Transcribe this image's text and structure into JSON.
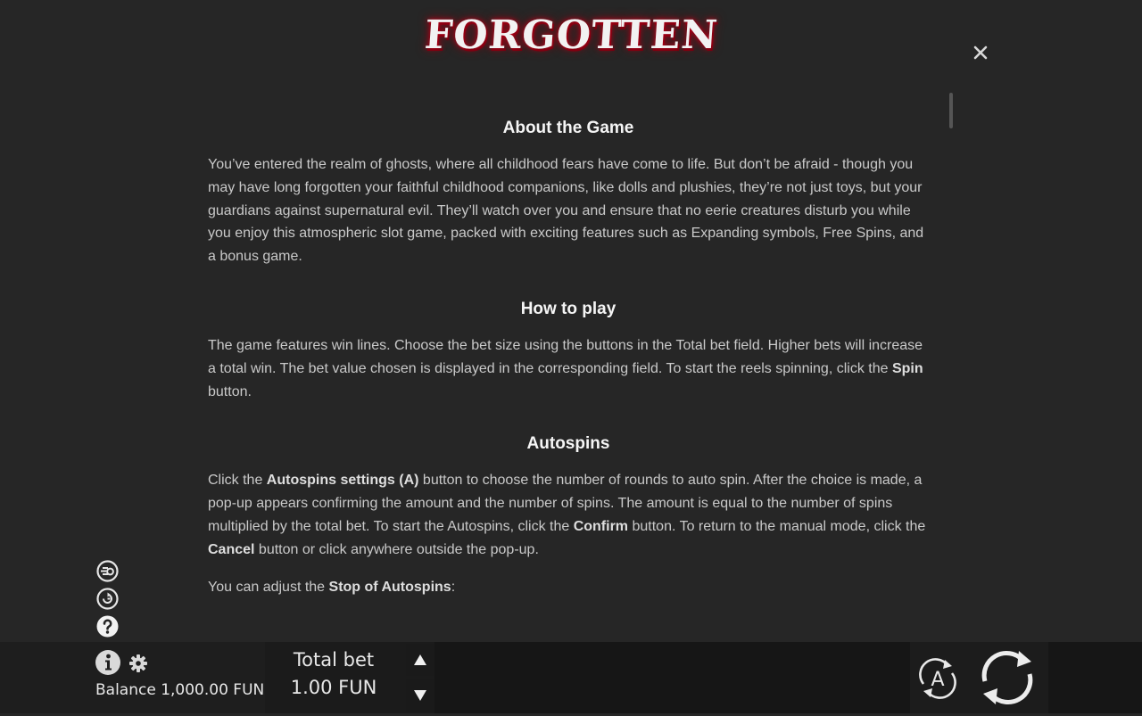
{
  "header": {
    "logo_text": "FORGOTTEN"
  },
  "sections": {
    "about": {
      "title": "About the Game",
      "text": "You’ve entered the realm of ghosts, where all childhood fears have come to life. But don’t be afraid - though you may have long forgotten your faithful childhood companions, like dolls and plushies, they’re not just toys, but your guardians against supernatural evil. They’ll watch over you and ensure that no eerie creatures disturb you while you enjoy this atmospheric slot game, packed with exciting features such as Expanding symbols, Free Spins, and a bonus game."
    },
    "how_to_play": {
      "title": "How to play",
      "text_before": "The game features win lines. Choose the bet size using the buttons in the Total bet field. Higher bets will increase a total win. The bet value chosen is displayed in the corresponding field. To start the reels spinning, click the ",
      "spin_bold": "Spin",
      "text_after": " button."
    },
    "autospins": {
      "title": "Autospins",
      "p1_a": "Click the ",
      "p1_b_bold": "Autospins settings (A)",
      "p1_c": " button to choose the number of rounds to auto spin. After the choice is made, a pop-up appears confirming the amount and the number of spins. The amount is equal to the number of spins multiplied by the total bet. To start the Autospins, click the ",
      "p1_d_bold": "Confirm",
      "p1_e": " button. To return to the manual mode, click the ",
      "p1_f_bold": "Cancel",
      "p1_g": " button or click anywhere outside the pop-up.",
      "p2_a": "You can adjust the ",
      "p2_b_bold": "Stop of Autospins",
      "p2_c": ":"
    }
  },
  "footer": {
    "balance": "Balance 1,000.00 FUN",
    "total_bet_label": "Total bet",
    "total_bet_value": "1.00 FUN",
    "auto_label": "A"
  }
}
